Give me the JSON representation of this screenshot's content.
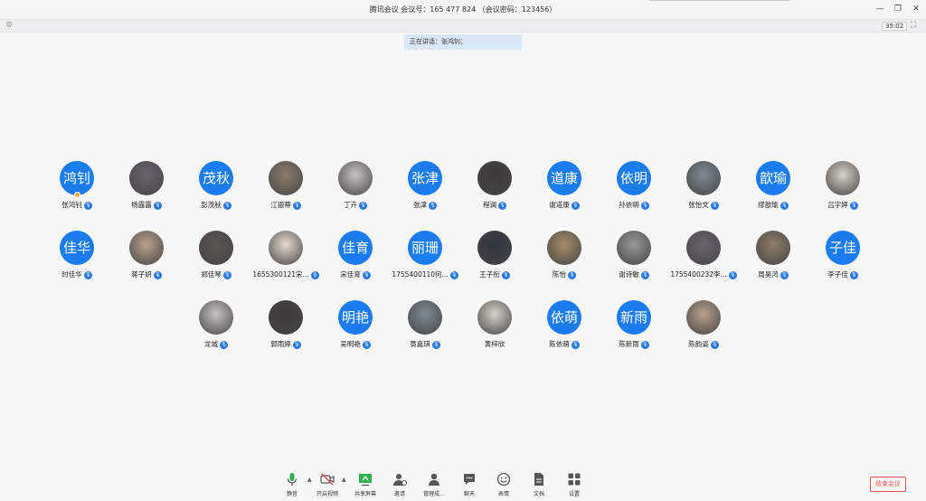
{
  "window": {
    "title": "腾讯会议 会议号：165 477 824 （会议密码：123456）",
    "timer": "35:02"
  },
  "speaking": "正在讲话：张鸿钊；",
  "participants": [
    {
      "name": "张鸿钊",
      "avatar_text": "鸿钊",
      "avatar_type": "text",
      "mic": true,
      "host": true
    },
    {
      "name": "杨露露",
      "avatar_text": "",
      "avatar_type": "photo",
      "mic": true
    },
    {
      "name": "彭茂秋",
      "avatar_text": "茂秋",
      "avatar_type": "text",
      "mic": true
    },
    {
      "name": "江银蒂",
      "avatar_text": "",
      "avatar_type": "photo",
      "mic": true
    },
    {
      "name": "丁卉",
      "avatar_text": "",
      "avatar_type": "photo",
      "mic": true
    },
    {
      "name": "张津",
      "avatar_text": "张津",
      "avatar_type": "text",
      "mic": true
    },
    {
      "name": "程澜",
      "avatar_text": "",
      "avatar_type": "photo",
      "mic": true
    },
    {
      "name": "谢道康",
      "avatar_text": "道康",
      "avatar_type": "text",
      "mic": true
    },
    {
      "name": "孙依明",
      "avatar_text": "依明",
      "avatar_type": "text",
      "mic": true
    },
    {
      "name": "张怡文",
      "avatar_text": "",
      "avatar_type": "photo",
      "mic": true
    },
    {
      "name": "缪歆瑜",
      "avatar_text": "歆瑜",
      "avatar_type": "text",
      "mic": true
    },
    {
      "name": "吕宇婷",
      "avatar_text": "",
      "avatar_type": "photo",
      "mic": true
    },
    {
      "name": "时佳华",
      "avatar_text": "佳华",
      "avatar_type": "text",
      "mic": true
    },
    {
      "name": "蒋子妍",
      "avatar_text": "",
      "avatar_type": "photo",
      "mic": true
    },
    {
      "name": "郑佳琴",
      "avatar_text": "",
      "avatar_type": "photo",
      "mic": true
    },
    {
      "name": "1655300121宋...",
      "avatar_text": "",
      "avatar_type": "photo",
      "mic": true
    },
    {
      "name": "宋佳育",
      "avatar_text": "佳育",
      "avatar_type": "text",
      "mic": true
    },
    {
      "name": "1755400110何...",
      "avatar_text": "丽珊",
      "avatar_type": "text",
      "mic": true
    },
    {
      "name": "王子衔",
      "avatar_text": "",
      "avatar_type": "photo",
      "mic": true
    },
    {
      "name": "陈怡",
      "avatar_text": "",
      "avatar_type": "photo",
      "mic": true
    },
    {
      "name": "谢诗敏",
      "avatar_text": "",
      "avatar_type": "photo",
      "mic": true
    },
    {
      "name": "1755400232李...",
      "avatar_text": "",
      "avatar_type": "photo",
      "mic": true
    },
    {
      "name": "周昊鸿",
      "avatar_text": "",
      "avatar_type": "photo",
      "mic": true
    },
    {
      "name": "李子佳",
      "avatar_text": "子佳",
      "avatar_type": "text",
      "mic": true
    },
    {
      "name": "龙城",
      "avatar_text": "",
      "avatar_type": "photo",
      "mic": true
    },
    {
      "name": "郭雨婷",
      "avatar_text": "",
      "avatar_type": "photo",
      "mic": true
    },
    {
      "name": "吴明艳",
      "avatar_text": "明艳",
      "avatar_type": "text",
      "mic": true
    },
    {
      "name": "黄嘉琪",
      "avatar_text": "",
      "avatar_type": "photo",
      "mic": true
    },
    {
      "name": "黄梓欣",
      "avatar_text": "",
      "avatar_type": "photo",
      "mic": false
    },
    {
      "name": "陈依萌",
      "avatar_text": "依萌",
      "avatar_type": "text",
      "mic": true
    },
    {
      "name": "陈新雨",
      "avatar_text": "新雨",
      "avatar_type": "text",
      "mic": true
    },
    {
      "name": "陈韵姿",
      "avatar_text": "",
      "avatar_type": "photo",
      "mic": true
    }
  ],
  "toolbar": {
    "items": [
      {
        "label": "静音",
        "icon": "microphone-icon"
      },
      {
        "label": "开启视频",
        "icon": "video-off-icon"
      },
      {
        "label": "共享屏幕",
        "icon": "share-screen-icon"
      },
      {
        "label": "邀请",
        "icon": "invite-user-icon"
      },
      {
        "label": "管理成...",
        "icon": "members-icon"
      },
      {
        "label": "聊天",
        "icon": "chat-icon"
      },
      {
        "label": "表情",
        "icon": "emoji-icon"
      },
      {
        "label": "文档",
        "icon": "document-icon"
      },
      {
        "label": "设置",
        "icon": "settings-icon"
      }
    ],
    "end_label": "结束会议"
  },
  "colors": {
    "accent": "#1a7cf0",
    "end": "#e0504a",
    "speaking_bg": "#d9e7f9"
  }
}
